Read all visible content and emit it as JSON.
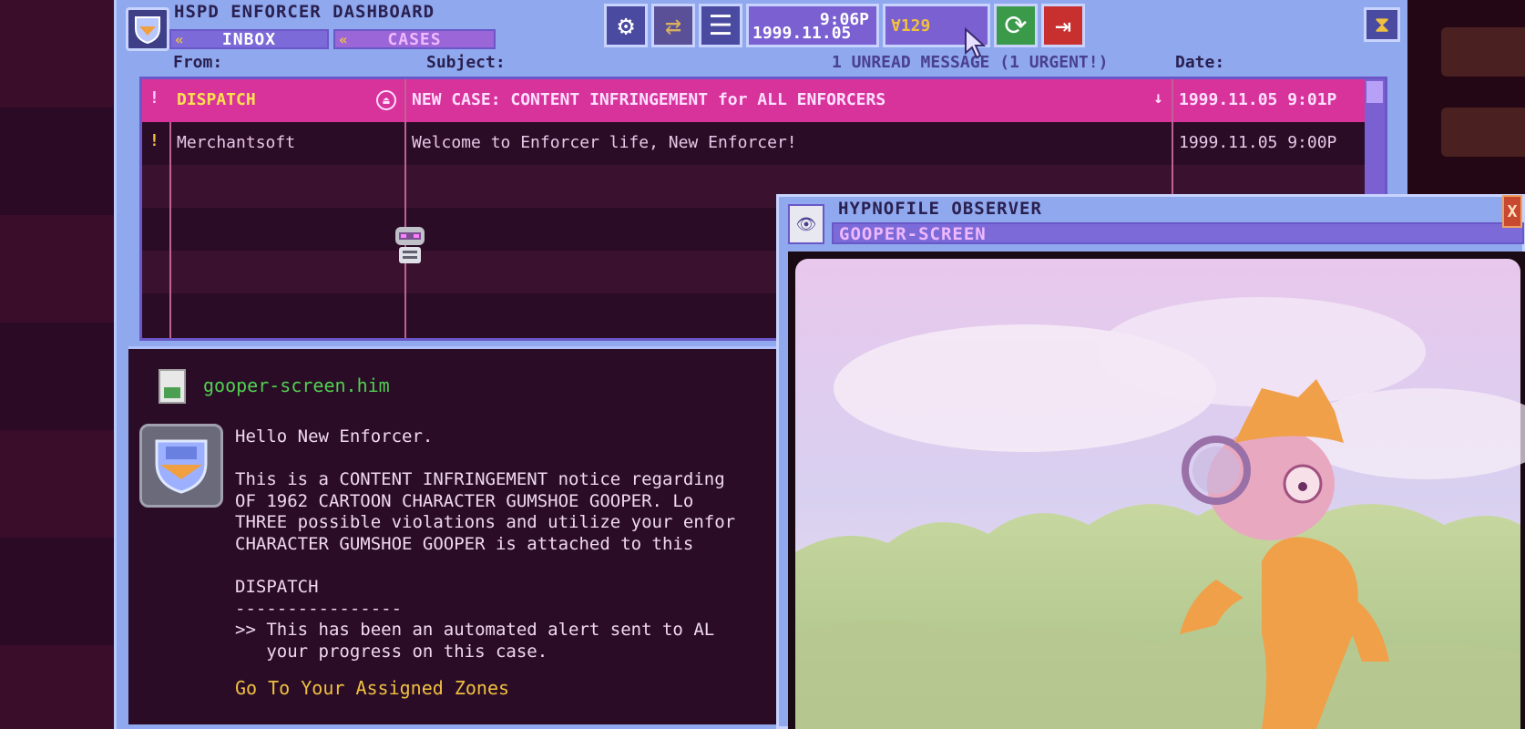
{
  "dashboard": {
    "title": "HSPD ENFORCER DASHBOARD",
    "tabs": {
      "inbox": "INBOX",
      "cases": "CASES"
    },
    "clock": {
      "time": "9:06P",
      "date": "1999.11.05"
    },
    "credits": "Ɐ129",
    "icons": [
      "gear-icon",
      "swap-icon",
      "menu-icon",
      "refresh-icon",
      "logout-icon",
      "hourglass-icon"
    ]
  },
  "inbox": {
    "headers": {
      "from": "From:",
      "subject": "Subject:",
      "date": "Date:"
    },
    "unread_status": "1 UNREAD MESSAGE (1 URGENT!)",
    "messages": [
      {
        "flag": "!",
        "from": "DISPATCH",
        "subject": "NEW CASE: CONTENT INFRINGEMENT for ALL ENFORCERS",
        "date": "1999.11.05 9:01P"
      },
      {
        "flag": "!",
        "from": "Merchantsoft",
        "subject": "Welcome to Enforcer life, New Enforcer!",
        "date": "1999.11.05 9:00P"
      }
    ]
  },
  "message": {
    "attachment": "gooper-screen.him",
    "greeting": "Hello New Enforcer.",
    "paragraph": "This is a CONTENT INFRINGEMENT notice regarding\nOF 1962 CARTOON CHARACTER GUMSHOE GOOPER. Lo\nTHREE possible violations and utilize your enfor\nCHARACTER GUMSHOE GOOPER is attached to this ",
    "signature": "DISPATCH\n----------------\n>> This has been an automated alert sent to AL\n   your progress on this case.",
    "link": "Go To Your Assigned Zones"
  },
  "observer": {
    "title": "HYPNOFILE OBSERVER",
    "file": "GOOPER-SCREEN",
    "close": "X"
  },
  "colors": {
    "window": "#8fa8ee",
    "selected_row": "#d8339a",
    "list_bg": "#2a0c26",
    "link": "#f0c040",
    "attachment": "#50d050"
  }
}
